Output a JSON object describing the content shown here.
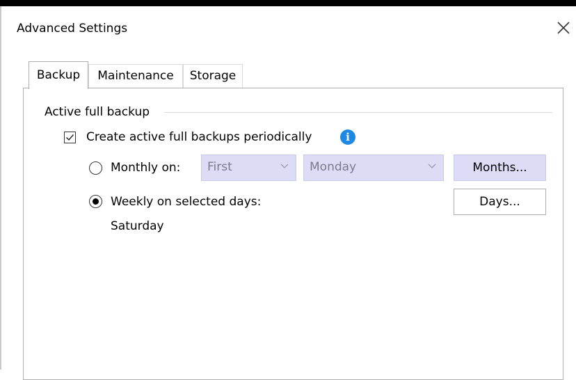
{
  "window": {
    "title": "Advanced Settings",
    "close_icon": "close-icon"
  },
  "tabs": [
    {
      "label": "Backup",
      "active": true
    },
    {
      "label": "Maintenance",
      "active": false
    },
    {
      "label": "Storage",
      "active": false
    }
  ],
  "group": {
    "title": "Active full backup",
    "checkbox_label": "Create active full backups periodically",
    "checkbox_checked": true,
    "info_icon": "info-icon",
    "monthly": {
      "label": "Monthly on:",
      "selected": false,
      "week_value": "First",
      "day_value": "Monday",
      "months_button": "Months..."
    },
    "weekly": {
      "label": "Weekly on selected days:",
      "selected": true,
      "days_summary": "Saturday",
      "days_button": "Days..."
    }
  },
  "colors": {
    "accent": "#1e88e5",
    "disabled_bg": "#dcdcf7"
  }
}
